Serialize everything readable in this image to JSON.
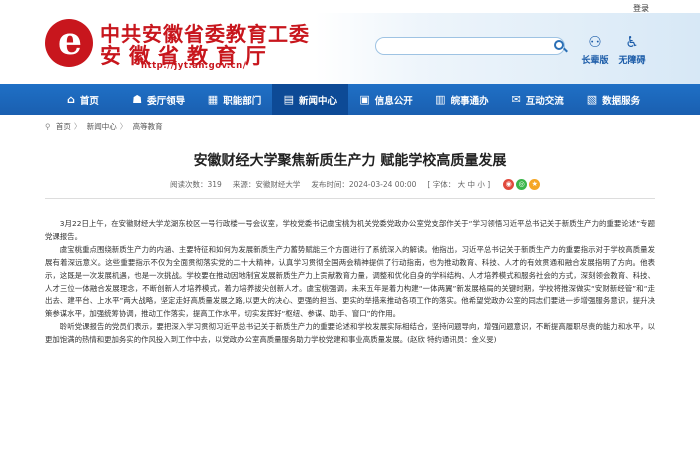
{
  "topbar": {
    "login": "登录"
  },
  "header": {
    "logo_letter": "e",
    "title_top": "中共安徽省委教育工委",
    "title_main": "安徽省教育厅",
    "url": "http://jyt.ah.gov.cn/",
    "search_placeholder": "",
    "tools": [
      {
        "label": "长辈版",
        "icon": "elder-mode-icon"
      },
      {
        "label": "无障碍",
        "icon": "accessibility-icon"
      }
    ]
  },
  "nav": {
    "items": [
      {
        "label": "首页",
        "icon": "home-icon",
        "active": false
      },
      {
        "label": "委厅领导",
        "icon": "leader-icon",
        "active": false
      },
      {
        "label": "职能部门",
        "icon": "department-icon",
        "active": false
      },
      {
        "label": "新闻中心",
        "icon": "news-icon",
        "active": true
      },
      {
        "label": "信息公开",
        "icon": "info-icon",
        "active": false
      },
      {
        "label": "皖事通办",
        "icon": "service-icon",
        "active": false
      },
      {
        "label": "互动交流",
        "icon": "chat-icon",
        "active": false
      },
      {
        "label": "数据服务",
        "icon": "data-icon",
        "active": false
      }
    ]
  },
  "breadcrumb": [
    "首页",
    "新闻中心",
    "高等教育"
  ],
  "article": {
    "title": "安徽财经大学聚焦新质生产力 赋能学校高质量发展",
    "meta": {
      "views_label": "阅读次数：",
      "views": "319",
      "source_label": "来源：",
      "source": "安徽财经大学",
      "date_label": "发布时间：",
      "date": "2024-03-24 00:00",
      "font_label": "[ 字体：",
      "font_large": "大",
      "font_medium": "中",
      "font_small": "小",
      "font_end": "]"
    },
    "paragraphs": [
      "3月22日上午，在安徽财经大学龙湖东校区一号行政楼一号会议室，学校党委书记虞宝桃为机关党委党政办公室党支部作关于“学习领悟习近平总书记关于新质生产力的重要论述”专题党课报告。",
      "虞宝桃重点围绕新质生产力的内涵、主要特征和如何为发展新质生产力蓄势赋能三个方面进行了系统深入的解读。他指出，习近平总书记关于新质生产力的重要指示对于学校高质量发展有着深远意义。这些重要指示不仅为全面贯彻落实党的二十大精神，认真学习贯彻全国两会精神提供了行动指南，也为推动教育、科技、人才的有效贯通和融合发展指明了方向。他表示，这既是一次发展机遇，也是一次挑战。学校要在推动因地制宜发展新质生产力上贡献教育力量，调整和优化自身的学科结构、人才培养模式和服务社会的方式，深刻领会教育、科技、人才三位一体融合发展理念，不断创新人才培养模式，着力培养拔尖创新人才。虞宝桃强调，未来五年是着力构建“一体两翼”新发展格局的关键时期，学校将推深做实“安财新经管”和“走出去、建平台、上水平”两大战略，坚定走好高质量发展之路,以更大的决心、更强的担当、更实的举措来推动各项工作的落实。他希望党政办公室的同志们要进一步增强服务意识，提升决策参谋水平，加强统筹协调，推动工作落实，提高工作水平，切实发挥好“枢纽、参谋、助手、窗口”的作用。",
      "聆听党课报告的党员们表示，要把深入学习贯彻习近平总书记关于新质生产力的重要论述和学校发展实际相结合，坚持问题导向，增强问题意识，不断提高履职尽责的能力和水平，以更加饱满的热情和更加务实的作风投入到工作中去，以党政办公室高质量服务助力学校党建和事业高质量发展。(赵欣 特约通讯员：金义旻)"
    ]
  },
  "colors": {
    "brand_red": "#c8161d",
    "nav_blue": "#1a5fb0",
    "nav_active": "#0d4a96"
  }
}
